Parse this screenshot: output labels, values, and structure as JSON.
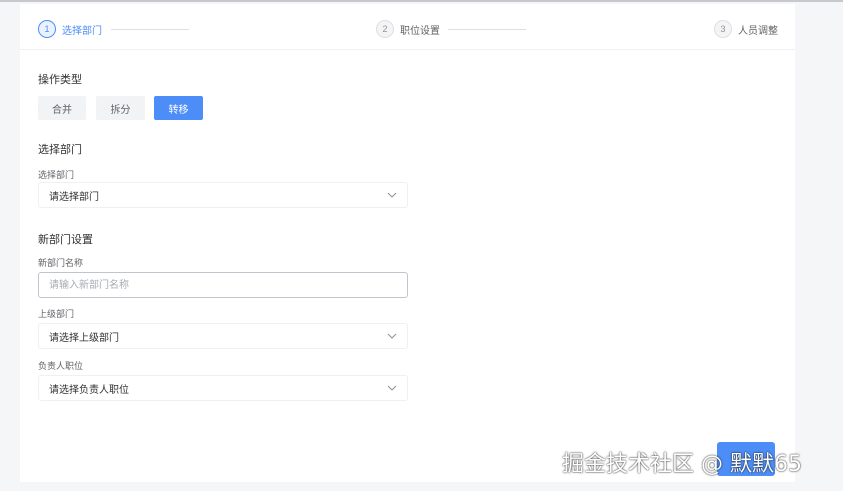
{
  "steps": [
    {
      "num": "1",
      "label": "选择部门",
      "active": true
    },
    {
      "num": "2",
      "label": "职位设置",
      "active": false
    },
    {
      "num": "3",
      "label": "人员调整",
      "active": false
    }
  ],
  "operation": {
    "title": "操作类型",
    "buttons": [
      {
        "label": "合并",
        "selected": false
      },
      {
        "label": "拆分",
        "selected": false
      },
      {
        "label": "转移",
        "selected": true
      }
    ]
  },
  "select_dept": {
    "title": "选择部门",
    "field_label": "选择部门",
    "value": "请选择部门"
  },
  "new_dept": {
    "title": "新部门设置",
    "name_label": "新部门名称",
    "name_placeholder": "请输入新部门名称",
    "parent_label": "上级部门",
    "parent_value": "请选择上级部门",
    "leader_label": "负责人职位",
    "leader_value": "请选择负责人职位"
  },
  "watermark": "掘金技术社区 @ 默默65",
  "colors": {
    "accent": "#4d8df7",
    "background": "#f5f6f8",
    "card": "#ffffff"
  },
  "icons": [
    "chevron-down-icon"
  ]
}
